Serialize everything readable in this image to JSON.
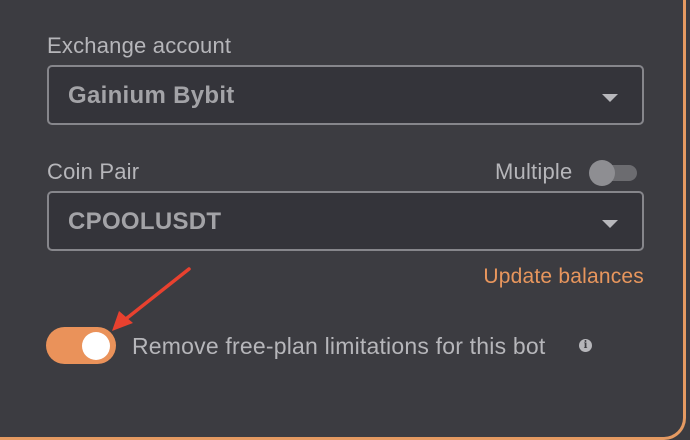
{
  "exchange": {
    "label": "Exchange account",
    "selected": "Gainium Bybit",
    "caret_icon": "chevron-down-icon"
  },
  "coin_pair": {
    "label": "Coin Pair",
    "multiple_label": "Multiple",
    "multiple_enabled": false,
    "selected": "CPOOLUSDT",
    "caret_icon": "chevron-down-icon"
  },
  "update_balances_label": "Update balances",
  "free_plan": {
    "label": "Remove free-plan limitations for this bot",
    "enabled": true,
    "info_icon": "info-icon"
  },
  "annotation": {
    "icon": "red-arrow-icon",
    "color": "#e8412f"
  },
  "colors": {
    "accent": "#ea925a",
    "background": "#3c3c41"
  }
}
